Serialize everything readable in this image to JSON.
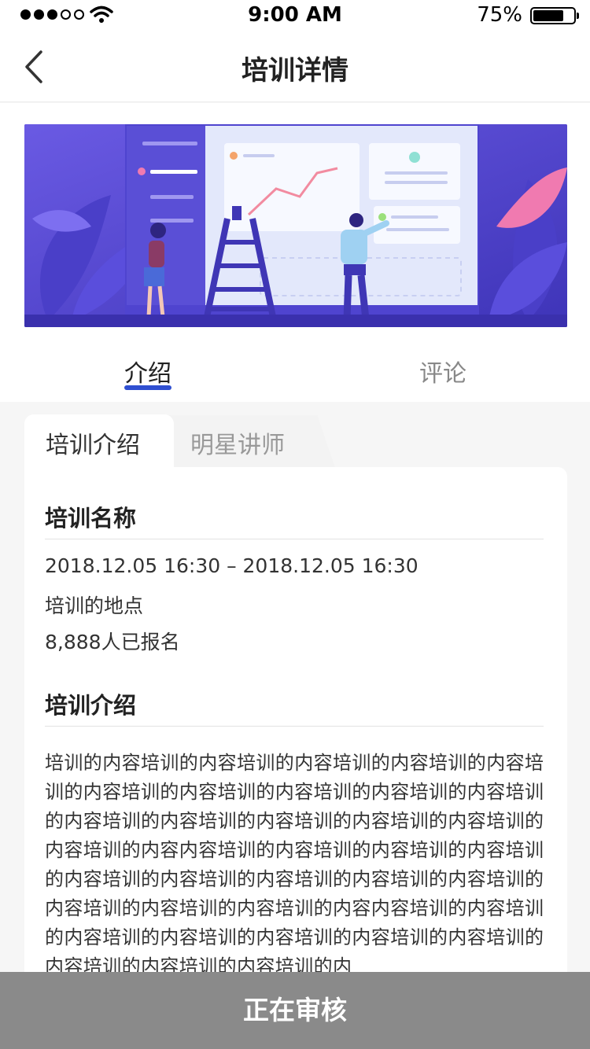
{
  "status_bar": {
    "time": "9:00 AM",
    "battery": "75%",
    "battery_level": 0.75,
    "signal_bars": 3
  },
  "nav": {
    "title": "培训详情",
    "back_icon": "chevron-left-icon"
  },
  "banner": {
    "image": "training-illustration"
  },
  "tabs": [
    {
      "label": "介绍",
      "active": true
    },
    {
      "label": "评论",
      "active": false
    }
  ],
  "subtabs": [
    {
      "label": "培训介绍",
      "active": true
    },
    {
      "label": "明星讲师",
      "active": false
    }
  ],
  "training": {
    "name_heading": "培训名称",
    "time": "2018.12.05  16:30 – 2018.12.05  16:30",
    "location": "培训的地点",
    "enrolled": "8,888人已报名",
    "intro_heading": "培训介绍",
    "intro_text": "培训的内容培训的内容培训的内容培训的内容培训的内容培训的内容培训的内容培训的内容培训的内容培训的内容培训的内容培训的内容培训的内容培训的内容培训的内容培训的内容培训的内容内容培训的内容培训的内容培训的内容培训的内容培训的内容培训的内容培训的内容培训的内容培训的内容培训的内容培训的内容培训的内容内容培训的内容培训的内容培训的内容培训的内容培训的内容培训的内容培训的内容培训的内容培训的内容培训的内"
  },
  "bottom_bar": {
    "label": "正在审核"
  },
  "colors": {
    "accent": "#2f4fd1",
    "bottom_bar": "#8a8a8a",
    "banner": "#5b4fd6"
  }
}
